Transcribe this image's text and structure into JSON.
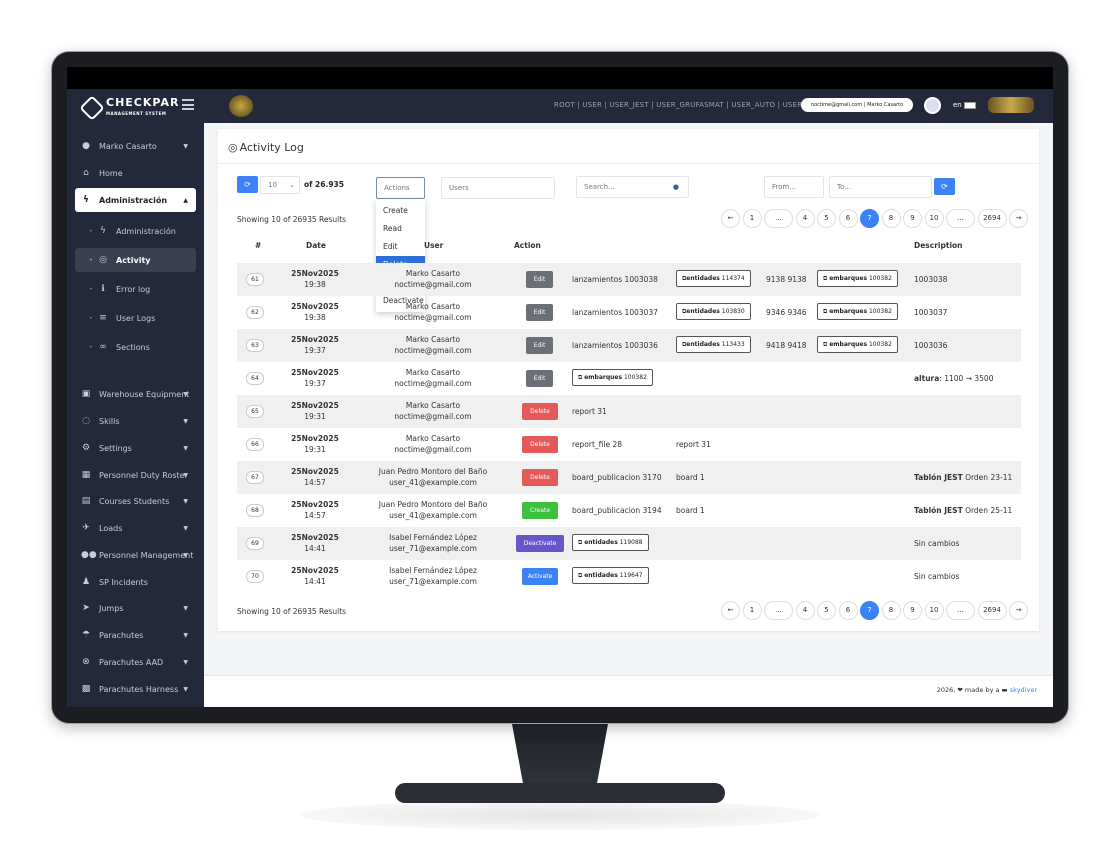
{
  "navbar": {
    "roles": "ROOT | USER | USER_JEST | USER_GRUFASMAT | USER_AUTO | USER",
    "user_pill": "noctime@gmail.com | Marko Casarto",
    "lang": "en"
  },
  "sidebar": {
    "items": [
      {
        "label": "Marko Casarto",
        "icon": "user-icon",
        "caret": true
      },
      {
        "label": "Home",
        "icon": "home-icon",
        "caret": false
      },
      {
        "label": "Administración",
        "icon": "bolt-icon",
        "caret": true,
        "active": true
      },
      {
        "label": "Administración",
        "icon": "bolt-icon",
        "sub": true
      },
      {
        "label": "Activity",
        "icon": "fingerprint-icon",
        "sub": true,
        "selected": true
      },
      {
        "label": "Error log",
        "icon": "info-icon",
        "sub": true
      },
      {
        "label": "User Logs",
        "icon": "list-icon",
        "sub": true
      },
      {
        "label": "Sections",
        "icon": "link-icon",
        "sub": true
      },
      {
        "label": "Warehouse Equipment",
        "icon": "box-icon",
        "caret": true
      },
      {
        "label": "Skills",
        "icon": "skill-icon",
        "caret": true
      },
      {
        "label": "Settings",
        "icon": "gear-icon",
        "caret": true
      },
      {
        "label": "Personnel Duty Roster",
        "icon": "calendar-icon",
        "caret": true
      },
      {
        "label": "Courses Students",
        "icon": "book-icon",
        "caret": true
      },
      {
        "label": "Loads",
        "icon": "plane-icon",
        "caret": true
      },
      {
        "label": "Personnel Management",
        "icon": "users-icon",
        "caret": true
      },
      {
        "label": "SP Incidents",
        "icon": "incident-icon",
        "caret": false
      },
      {
        "label": "Jumps",
        "icon": "jump-icon",
        "caret": true
      },
      {
        "label": "Parachutes",
        "icon": "parachute-icon",
        "caret": true
      },
      {
        "label": "Parachutes AAD",
        "icon": "aad-icon",
        "caret": true
      },
      {
        "label": "Parachutes Harness",
        "icon": "harness-icon",
        "caret": true
      }
    ]
  },
  "page": {
    "title": "Activity Log",
    "per_page": "10",
    "of_count": "of 26.935",
    "actions_placeholder": "Actions",
    "users_placeholder": "Users",
    "search_placeholder": "Search...",
    "from_placeholder": "From...",
    "to_placeholder": "To...",
    "showing": "Showing 10 of 26935 Results"
  },
  "actions_menu": [
    "Create",
    "Read",
    "Edit",
    "Delete",
    "Activate",
    "Deactivate"
  ],
  "pagination": [
    "1",
    "...",
    "4",
    "5",
    "6",
    "7",
    "8",
    "9",
    "10",
    "...",
    "2694"
  ],
  "pagination_active": "7",
  "table": {
    "headers": {
      "num": "#",
      "date": "Date",
      "user": "User",
      "action": "Action",
      "description": "Description"
    },
    "rows": [
      {
        "num": "61",
        "date": "25Nov2025",
        "time": "19:38",
        "name": "Marko Casarto",
        "email": "noctime@gmail.com",
        "action": "Edit",
        "action_color": "#6b6f76",
        "col1": "lanzamientos 1003038",
        "tag1_label": "entidades",
        "tag1_num": "114374",
        "col3": "9138 9138",
        "tag2_label": "embarques",
        "tag2_num": "100382",
        "desc_b": "",
        "desc": "1003038"
      },
      {
        "num": "62",
        "date": "25Nov2025",
        "time": "19:38",
        "name": "Marko Casarto",
        "email": "noctime@gmail.com",
        "action": "Edit",
        "action_color": "#6b6f76",
        "col1": "lanzamientos 1003037",
        "tag1_label": "entidades",
        "tag1_num": "103830",
        "col3": "9346 9346",
        "tag2_label": "embarques",
        "tag2_num": "100382",
        "desc_b": "",
        "desc": "1003037"
      },
      {
        "num": "63",
        "date": "25Nov2025",
        "time": "19:37",
        "name": "Marko Casarto",
        "email": "noctime@gmail.com",
        "action": "Edit",
        "action_color": "#6b6f76",
        "col1": "lanzamientos 1003036",
        "tag1_label": "entidades",
        "tag1_num": "113433",
        "col3": "9418 9418",
        "tag2_label": "embarques",
        "tag2_num": "100382",
        "desc_b": "",
        "desc": "1003036"
      },
      {
        "num": "64",
        "date": "25Nov2025",
        "time": "19:37",
        "name": "Marko Casarto",
        "email": "noctime@gmail.com",
        "action": "Edit",
        "action_color": "#6b6f76",
        "tagA_label": "embarques",
        "tagA_num": "100382",
        "desc_b": "altura",
        "desc": ": 1100 → 3500"
      },
      {
        "num": "65",
        "date": "25Nov2025",
        "time": "19:31",
        "name": "Marko Casarto",
        "email": "noctime@gmail.com",
        "action": "Delete",
        "action_color": "#e45a5a",
        "col1": "report 31",
        "desc_b": "",
        "desc": ""
      },
      {
        "num": "66",
        "date": "25Nov2025",
        "time": "19:31",
        "name": "Marko Casarto",
        "email": "noctime@gmail.com",
        "action": "Delete",
        "action_color": "#e45a5a",
        "col1": "report_file 28",
        "col2": "report 31",
        "desc_b": "",
        "desc": ""
      },
      {
        "num": "67",
        "date": "25Nov2025",
        "time": "14:57",
        "name": "Juan Pedro Montoro del Baño",
        "email": "user_41@example.com",
        "action": "Delete",
        "action_color": "#e45a5a",
        "col1": "board_publicacion 3170",
        "col2": "board 1",
        "desc_b": "Tablón JEST",
        "desc": " Orden 23-11"
      },
      {
        "num": "68",
        "date": "25Nov2025",
        "time": "14:57",
        "name": "Juan Pedro Montoro del Baño",
        "email": "user_41@example.com",
        "action": "Create",
        "action_color": "#3dc13d",
        "col1": "board_publicacion 3194",
        "col2": "board 1",
        "desc_b": "Tablón JEST",
        "desc": " Orden 25-11"
      },
      {
        "num": "69",
        "date": "25Nov2025",
        "time": "14:41",
        "name": "Isabel Fernández López",
        "email": "user_71@example.com",
        "action": "Deactivate",
        "action_color": "#6557c9",
        "tagA_label": "entidades",
        "tagA_num": "119088",
        "desc_b": "",
        "desc": "Sin cambios"
      },
      {
        "num": "70",
        "date": "25Nov2025",
        "time": "14:41",
        "name": "Isabel Fernández López",
        "email": "user_71@example.com",
        "action": "Activate",
        "action_color": "#3b82f6",
        "tagA_label": "entidades",
        "tagA_num": "119647",
        "desc_b": "",
        "desc": "Sin cambios"
      }
    ]
  },
  "footer": {
    "text": "2026, ❤ made by a",
    "link": "skydiver"
  },
  "colors": {
    "accent": "#3b82f6",
    "sidebar": "#23283a",
    "delete": "#e45a5a",
    "create": "#3dc13d",
    "deactivate": "#6557c9"
  }
}
